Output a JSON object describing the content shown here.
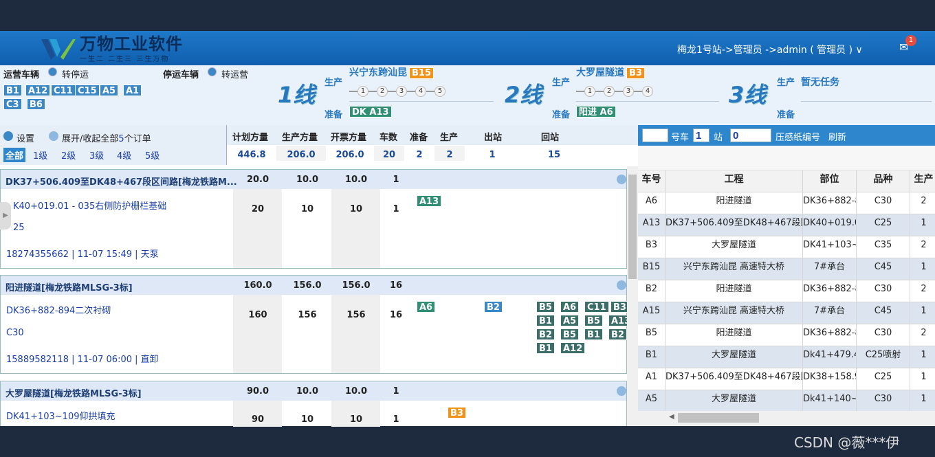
{
  "header": {
    "brand": "万物工业软件",
    "slogan": "一生二 二生三 三生万物",
    "user": "梅龙1号站->管理员 ->admin ( 管理员 ) ∨",
    "mail_count": "1"
  },
  "vehicles": {
    "running_label": "运营车辆",
    "to_stop": "转停运",
    "stopped_label": "停运车辆",
    "to_run": "转运营",
    "running": [
      "B1",
      "A12",
      "C11",
      "C15",
      "A5",
      "A1",
      "C3",
      "B6"
    ]
  },
  "lines": [
    {
      "name": "1线",
      "produce_label": "生产",
      "project": "兴宁东跨汕昆",
      "car": "B15",
      "steps": [
        "1",
        "2",
        "3",
        "4",
        "5"
      ],
      "prepare_label": "准备",
      "prepare": "DK A13"
    },
    {
      "name": "2线",
      "produce_label": "生产",
      "project": "大罗屋隧道",
      "car": "B3",
      "steps": [
        "1",
        "2",
        "3",
        "4"
      ],
      "prepare_label": "准备",
      "prepare": "阳进 A6"
    },
    {
      "name": "3线",
      "produce_label": "生产",
      "project": "暂无任务",
      "prepare_label": "准备"
    }
  ],
  "controls": {
    "settings": "设置",
    "toggle": "展开/收起全部",
    "count": "5",
    "count_suffix": "个订单",
    "levels": [
      "全部",
      "1级",
      "2级",
      "3级",
      "4级",
      "5级"
    ]
  },
  "summary": {
    "headers": [
      "计划方量",
      "生产方量",
      "开票方量",
      "车数",
      "准备",
      "生产",
      "出站",
      "回站"
    ],
    "values": [
      "446.8",
      "206.0",
      "206.0",
      "20",
      "2",
      "2",
      "1",
      "15"
    ]
  },
  "orders": [
    {
      "title": "DK37+506.409至DK48+467段区间路[梅龙铁路M...",
      "plan": "20.0",
      "prod": "10.0",
      "ticket": "10.0",
      "cars": "1",
      "part": "K40+019.01 - 035右侧防护栅栏基础",
      "grade": "25",
      "contact": "18274355662 |  11-07 15:49 | 天泵",
      "b_plan": "20",
      "b_prod": "10",
      "b_ticket": "10",
      "b_cars": "1",
      "prep": [
        "A13"
      ]
    },
    {
      "title": "阳进隧道[梅龙铁路MLSG-3标]",
      "plan": "160.0",
      "prod": "156.0",
      "ticket": "156.0",
      "cars": "16",
      "part": "DK36+882-894二次衬砌",
      "grade": "C30",
      "contact": "15889582118 |  11-07 06:00 | 直卸",
      "b_plan": "160",
      "b_prod": "156",
      "b_ticket": "156",
      "b_cars": "16",
      "prep": [
        "A6"
      ],
      "out": [
        "B2"
      ],
      "back": [
        "B5",
        "A6",
        "C11",
        "B3",
        "B1",
        "A5",
        "B5",
        "A13",
        "B2",
        "B5",
        "B1",
        "B2",
        "B1",
        "A12"
      ]
    },
    {
      "title": "大罗屋隧道[梅龙铁路MLSG-3标]",
      "plan": "90.0",
      "prod": "10.0",
      "ticket": "10.0",
      "cars": "1",
      "part": "DK41+103~109仰拱填充",
      "b_plan": "90",
      "b_prod": "10",
      "b_ticket": "10",
      "b_cars": "1",
      "produce": [
        "B3"
      ]
    }
  ],
  "right": {
    "car_label": "号车",
    "car_no": "1",
    "station_label": "站",
    "station_no": "0",
    "paper_label": "压感纸编号",
    "refresh": "刷新",
    "columns": [
      "车号",
      "工程",
      "部位",
      "品种",
      "生产"
    ],
    "rows": [
      [
        "A6",
        "阳进隧道",
        "DK36+882-8",
        "C30",
        "2"
      ],
      [
        "A13",
        "DK37+506.409至DK48+467段区",
        "DK40+019.0",
        "C25",
        "1"
      ],
      [
        "B3",
        "大罗屋隧道",
        "DK41+103~",
        "C35",
        "2"
      ],
      [
        "B15",
        "兴宁东跨汕昆 高速特大桥",
        "7#承台",
        "C45",
        "1"
      ],
      [
        "B2",
        "阳进隧道",
        "DK36+882-8",
        "C30",
        "2"
      ],
      [
        "A15",
        "兴宁东跨汕昆 高速特大桥",
        "7#承台",
        "C45",
        "1"
      ],
      [
        "B5",
        "阳进隧道",
        "DK36+882-8",
        "C30",
        "2"
      ],
      [
        "B1",
        "大罗屋隧道",
        "Dk41+479.4",
        "C25喷射",
        "1"
      ],
      [
        "A1",
        "DK37+506.409至DK48+467段区",
        "DK38+158.9",
        "C25",
        "1"
      ],
      [
        "A5",
        "大罗屋隧道",
        "Dk41+140~",
        "C30",
        "1"
      ]
    ]
  },
  "watermark": "CSDN @薇***伊"
}
